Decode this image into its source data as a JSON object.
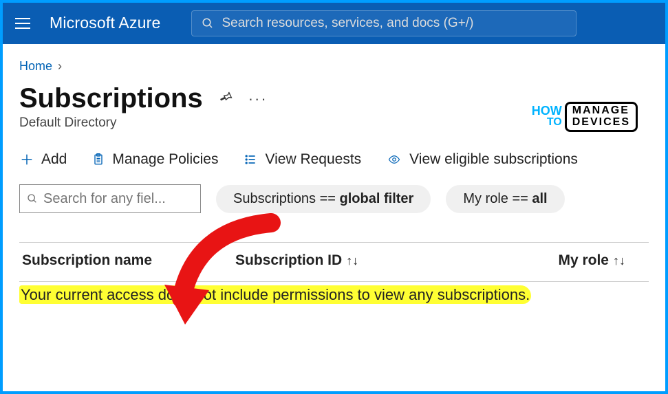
{
  "header": {
    "brand": "Microsoft Azure",
    "search_placeholder": "Search resources, services, and docs (G+/)"
  },
  "breadcrumb": {
    "home": "Home"
  },
  "page": {
    "title": "Subscriptions",
    "subtitle": "Default Directory"
  },
  "toolbar": {
    "add": "Add",
    "manage_policies": "Manage Policies",
    "view_requests": "View Requests",
    "view_eligible": "View eligible subscriptions"
  },
  "filters": {
    "search_placeholder": "Search for any fiel...",
    "pill_sub_label": "Subscriptions == ",
    "pill_sub_value": "global filter",
    "pill_role_label": "My role == ",
    "pill_role_value": "all"
  },
  "columns": {
    "name": "Subscription name",
    "id": "Subscription ID",
    "role": "My role"
  },
  "message": "Your current access does not include permissions to view any subscriptions.",
  "watermark": {
    "how": "HOW",
    "to": "TO",
    "manage": "MANAGE",
    "devices": "DEVICES"
  }
}
